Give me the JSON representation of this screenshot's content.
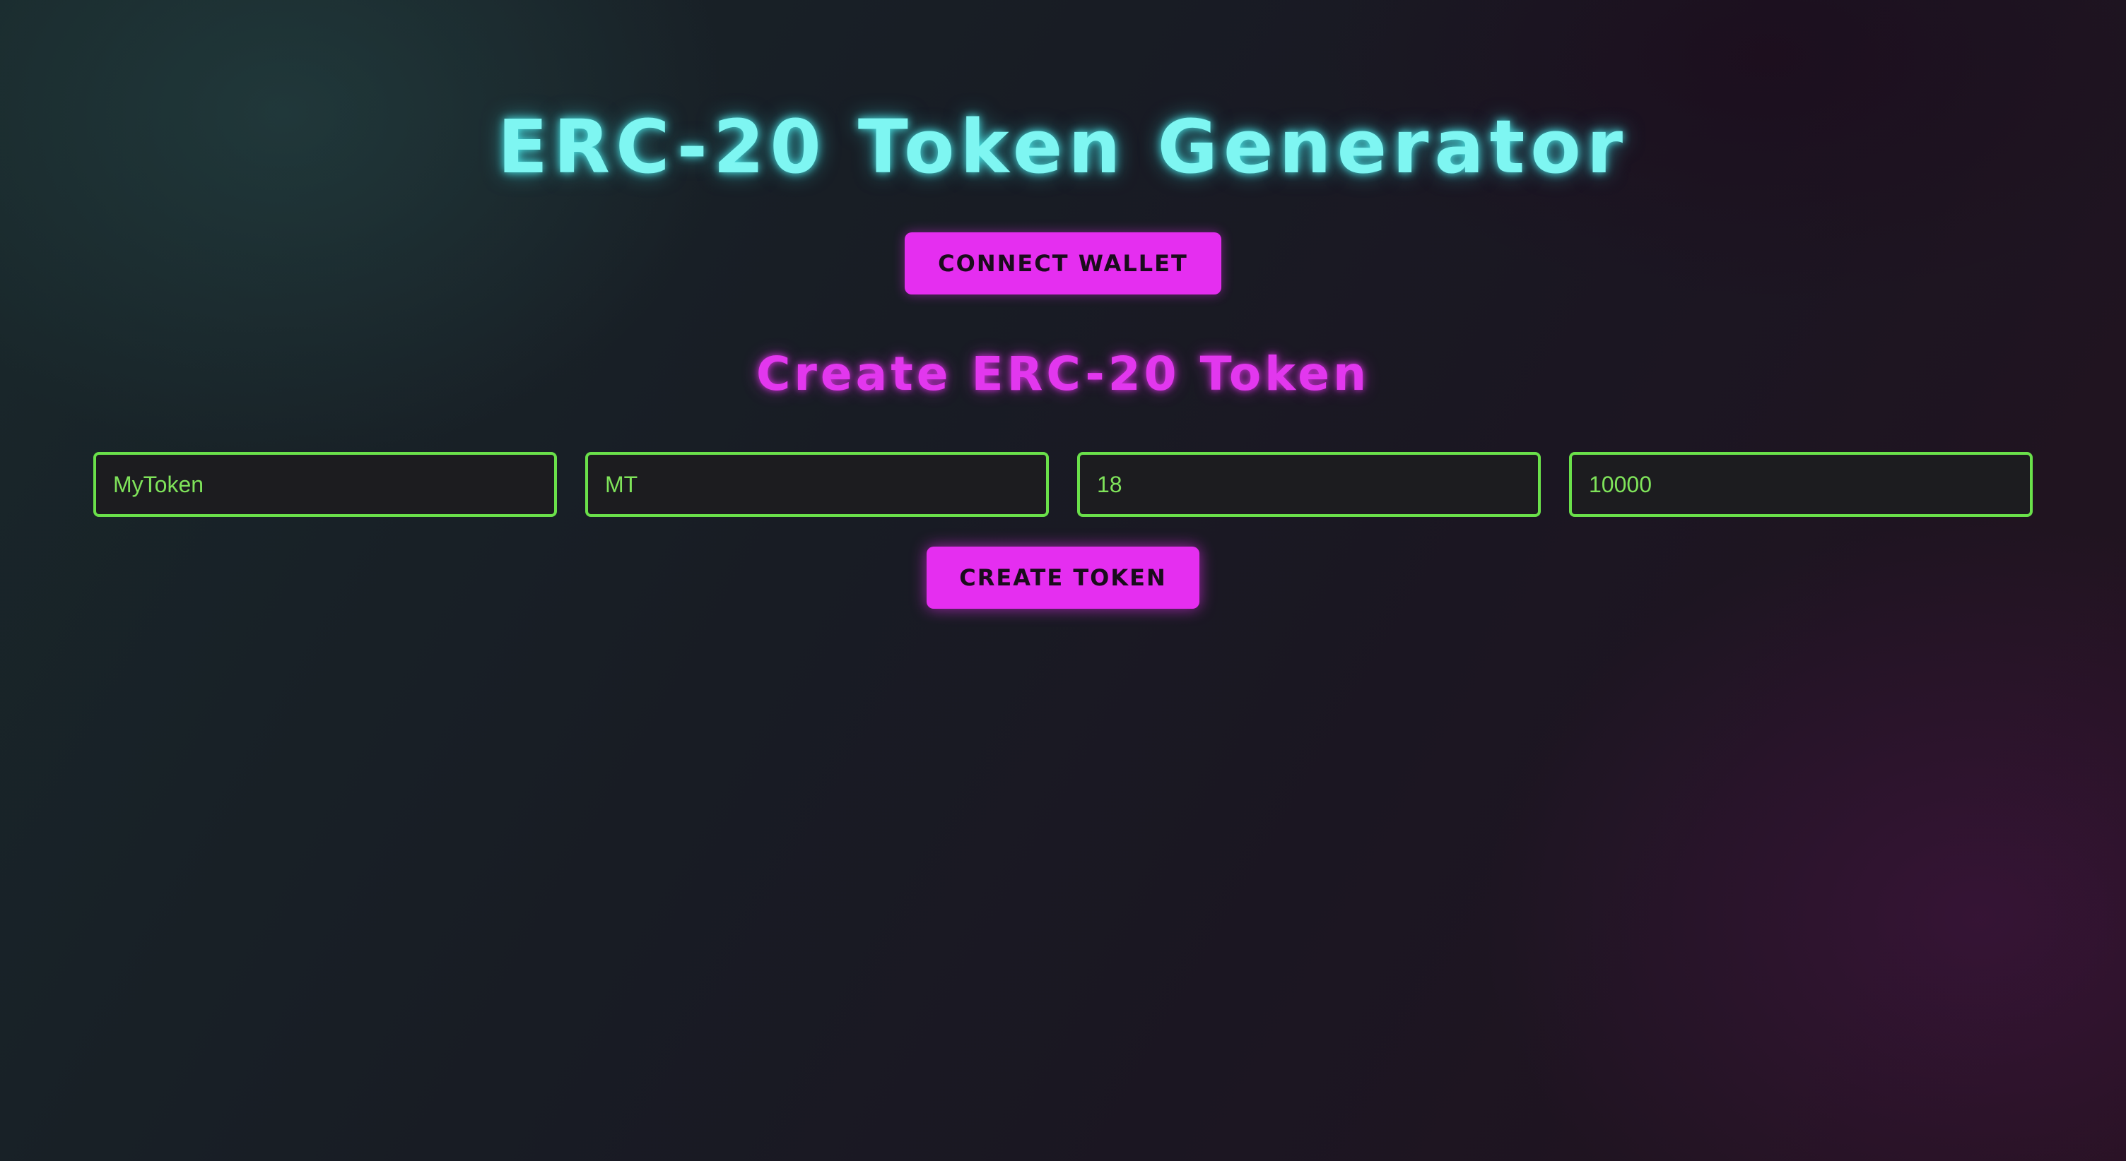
{
  "header": {
    "title": "ERC-20 Token Generator"
  },
  "wallet": {
    "connect_label": "CONNECT WALLET"
  },
  "form": {
    "section_title": "Create ERC-20 Token",
    "fields": [
      {
        "value": "MyToken"
      },
      {
        "value": "MT"
      },
      {
        "value": "18"
      },
      {
        "value": "10000"
      }
    ],
    "submit_label": "CREATE TOKEN"
  },
  "colors": {
    "title": "#7ef6f2",
    "accent": "#e52ef0",
    "input_border": "#6ae04a",
    "input_text": "#7fe35a"
  }
}
